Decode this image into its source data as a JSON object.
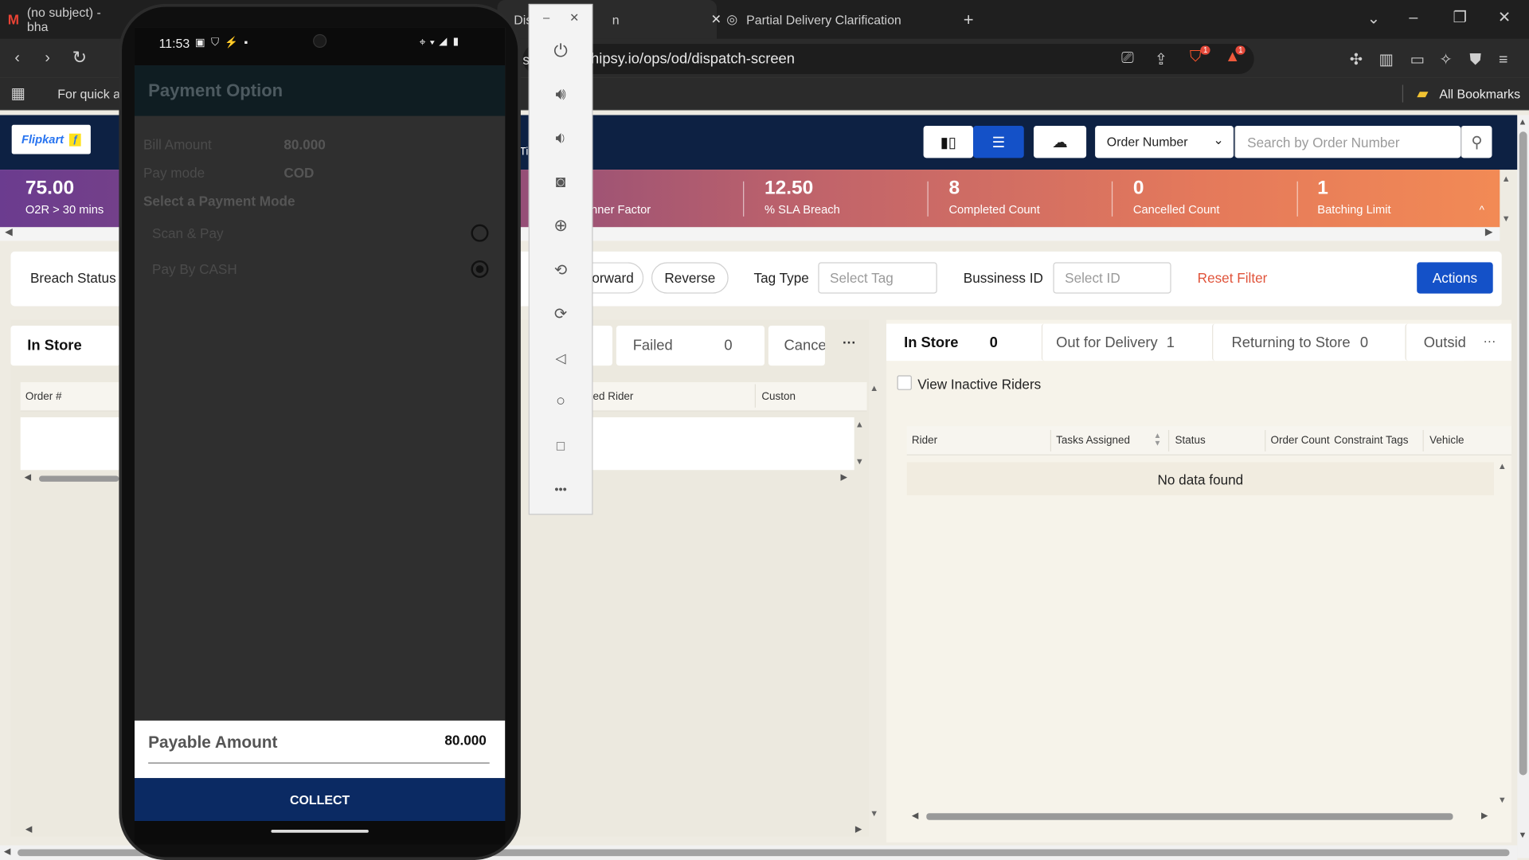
{
  "browser": {
    "tabs": [
      {
        "title": "(no subject) - bha"
      },
      {
        "title": "Dis"
      },
      {
        "title": "n"
      },
      {
        "title": "Partial Delivery Clarification"
      }
    ],
    "new_tab": "+",
    "url": "hipsy.io/ops/od/dispatch-screen",
    "url_prefix": "sa",
    "bookmarks_prompt": "For quick ac",
    "all_bookmarks": "All Bookmarks",
    "badge_count_1": "1",
    "badge_count_2": "1"
  },
  "app": {
    "logo_text": "Flipkart",
    "search_type": "Order Number",
    "search_placeholder": "Search by Order Number",
    "header_fragment": "Ti",
    "stats": [
      {
        "value": "75.00",
        "label": "O2R > 30 mins"
      },
      {
        "value": "",
        "label": "nner Factor"
      },
      {
        "value": "12.50",
        "label": "% SLA Breach"
      },
      {
        "value": "8",
        "label": "Completed Count"
      },
      {
        "value": "0",
        "label": "Cancelled Count"
      },
      {
        "value": "1",
        "label": "Batching Limit"
      }
    ],
    "filter": {
      "breach_status": "Breach Status",
      "forward": "orward",
      "reverse": "Reverse",
      "tag_type": "Tag Type",
      "tag_placeholder": "Select Tag",
      "business_id": "Bussiness ID",
      "id_placeholder": "Select ID",
      "reset": "Reset Filter",
      "actions": "Actions"
    },
    "orders": {
      "tab_in_store": "In Store",
      "tab_failed": "Failed",
      "failed_count": "0",
      "tab_cancel": "Cance",
      "more": "···",
      "col_order": "Order #",
      "col_rider": "ed Rider",
      "col_customer": "Custon"
    },
    "riders": {
      "tabs": [
        {
          "label": "In Store",
          "count": "0"
        },
        {
          "label": "Out for Delivery",
          "count": "1"
        },
        {
          "label": "Returning to Store",
          "count": "0"
        },
        {
          "label": "Outsid",
          "count": ""
        }
      ],
      "more": "···",
      "inactive_label": "View Inactive Riders",
      "columns": [
        "Rider",
        "Tasks Assigned",
        "Status",
        "Order Count",
        "Constraint Tags",
        "Vehicle"
      ],
      "empty": "No data found"
    }
  },
  "phone": {
    "time": "11:53",
    "title": "Payment Option",
    "bill_amount_label": "Bill Amount",
    "bill_amount": "80.000",
    "pay_mode_label": "Pay mode",
    "pay_mode": "COD",
    "select_mode": "Select a Payment Mode",
    "options": [
      {
        "label": "Scan & Pay",
        "selected": false
      },
      {
        "label": "Pay By CASH",
        "selected": true
      }
    ],
    "payable_label": "Payable Amount",
    "payable_amount": "80.000",
    "collect": "COLLECT"
  },
  "emulator": {
    "icons": [
      "power-icon",
      "volume-up-icon",
      "volume-down-icon",
      "camera-icon",
      "zoom-icon",
      "rotate-left-icon",
      "rotate-right-icon",
      "back-icon",
      "home-icon",
      "overview-icon",
      "more-icon"
    ],
    "more": "•••"
  },
  "colors": {
    "navy": "#0d2143",
    "accent_blue": "#1451c8",
    "reset_red": "#e0533a",
    "collect": "#0b2a63"
  }
}
